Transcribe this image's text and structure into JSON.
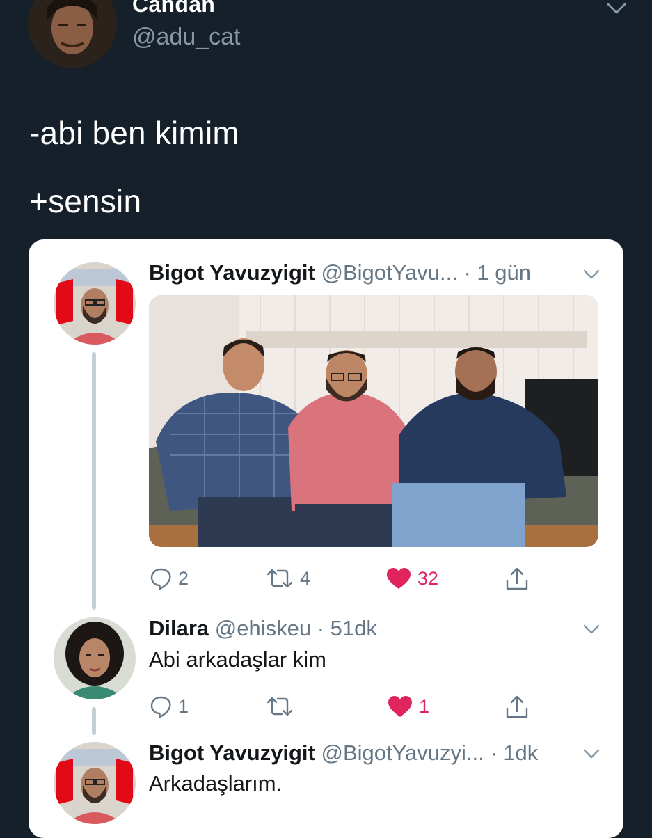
{
  "outer_tweet": {
    "author_name": "Candan",
    "author_handle": "@adu_cat",
    "lines": [
      "-abi ben kimim",
      "+sensin"
    ]
  },
  "quoted_thread": [
    {
      "name": "Bigot Yavuzyigit",
      "handle": "@BigotYavu...",
      "time": "· 1 gün",
      "text": "",
      "replies": "2",
      "retweets": "4",
      "likes": "32"
    },
    {
      "name": "Dilara",
      "handle": "@ehiskeu",
      "time": "· 51dk",
      "text": "Abi arkadaşlar kim",
      "replies": "1",
      "retweets": "",
      "likes": "1"
    },
    {
      "name": "Bigot Yavuzyigit",
      "handle": "@BigotYavuzyi...",
      "time": "· 1dk",
      "text": "Arkadaşlarım."
    }
  ],
  "colors": {
    "background": "#15202b",
    "like": "#e0245e",
    "secondary": "#657786"
  },
  "icons": [
    "reply-icon",
    "retweet-icon",
    "heart-icon",
    "share-icon",
    "chevron-down-icon"
  ]
}
